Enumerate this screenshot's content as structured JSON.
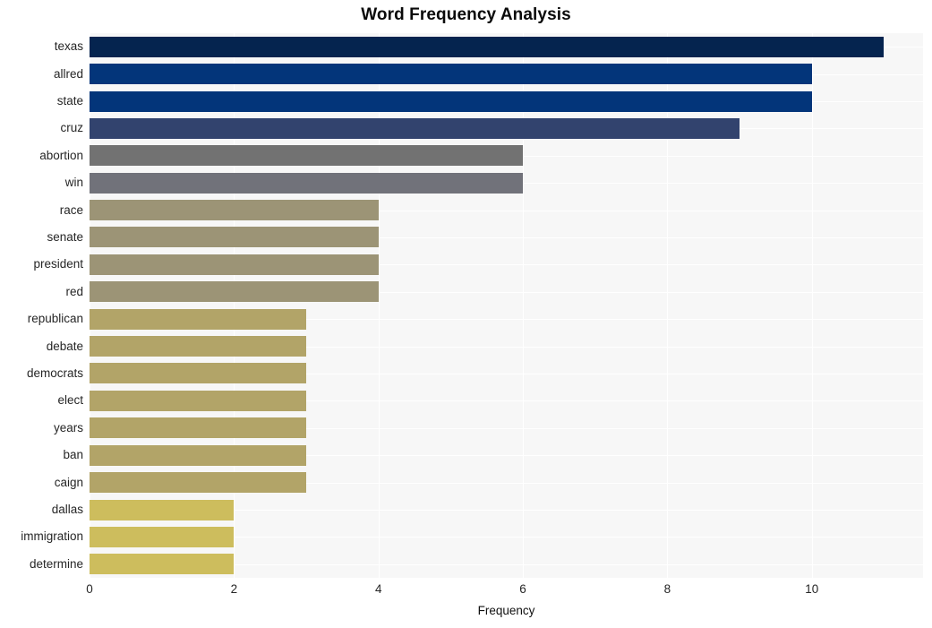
{
  "chart_data": {
    "type": "bar",
    "orientation": "horizontal",
    "title": "Word Frequency Analysis",
    "xlabel": "Frequency",
    "ylabel": "",
    "categories": [
      "texas",
      "allred",
      "state",
      "cruz",
      "abortion",
      "win",
      "race",
      "senate",
      "president",
      "red",
      "republican",
      "debate",
      "democrats",
      "elect",
      "years",
      "ban",
      "caign",
      "dallas",
      "immigration",
      "determine"
    ],
    "values": [
      11,
      10,
      10,
      9,
      6,
      6,
      4,
      4,
      4,
      4,
      3,
      3,
      3,
      3,
      3,
      3,
      3,
      2,
      2,
      2
    ],
    "bar_colors": [
      "#05244f",
      "#03357a",
      "#03357a",
      "#32436e",
      "#727272",
      "#71727a",
      "#9c9476",
      "#9c9476",
      "#9c9476",
      "#9c9476",
      "#b2a468",
      "#b2a468",
      "#b2a468",
      "#b2a468",
      "#b2a468",
      "#b2a468",
      "#b2a468",
      "#cdbd5d",
      "#cdbd5d",
      "#cdbd5d"
    ],
    "xlim": [
      0,
      11.54
    ],
    "xticks": [
      0,
      2,
      4,
      6,
      8,
      10
    ],
    "xtick_labels": [
      "0",
      "2",
      "4",
      "6",
      "8",
      "10"
    ],
    "grid": true,
    "grid_color": "#ffffff",
    "plot_background": "#f7f7f7",
    "figure_background": "#ffffff",
    "legend": "none"
  }
}
